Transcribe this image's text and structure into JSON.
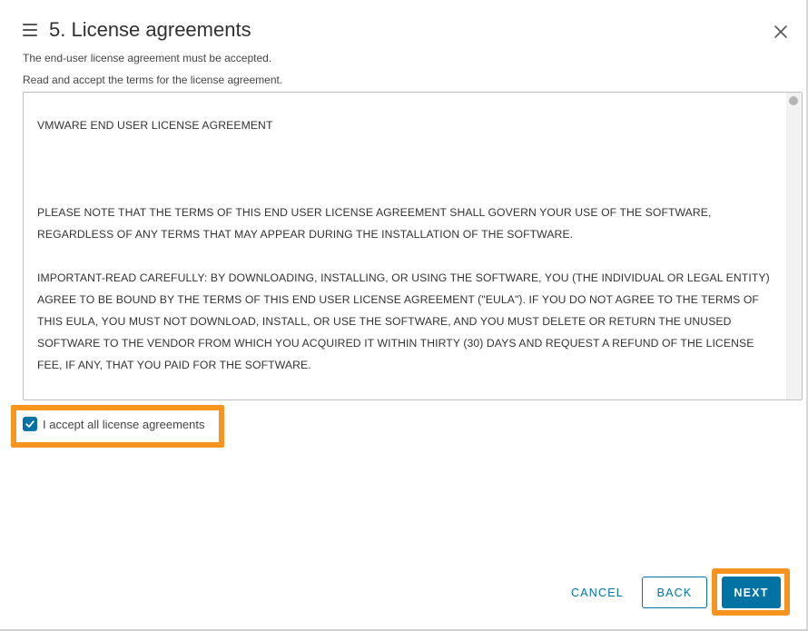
{
  "header": {
    "title": "5. License agreements"
  },
  "messages": {
    "required": "The end-user license agreement must be accepted.",
    "instruction": "Read and accept the terms for the license agreement."
  },
  "license": {
    "heading": "VMWARE END USER LICENSE AGREEMENT",
    "paragraph1": "PLEASE NOTE THAT THE TERMS OF THIS END USER LICENSE AGREEMENT SHALL GOVERN YOUR USE OF THE SOFTWARE, REGARDLESS OF ANY TERMS THAT MAY APPEAR DURING THE INSTALLATION OF THE SOFTWARE.",
    "paragraph2": "IMPORTANT-READ CAREFULLY: BY DOWNLOADING, INSTALLING, OR USING THE SOFTWARE, YOU (THE INDIVIDUAL OR LEGAL ENTITY) AGREE TO BE BOUND BY THE TERMS OF THIS END USER LICENSE AGREEMENT (\"EULA\"). IF YOU DO NOT AGREE TO THE TERMS OF THIS EULA, YOU MUST NOT DOWNLOAD, INSTALL, OR USE THE SOFTWARE, AND YOU MUST DELETE OR RETURN THE UNUSED SOFTWARE TO THE VENDOR FROM WHICH YOU ACQUIRED IT WITHIN THIRTY (30) DAYS AND REQUEST A REFUND OF THE LICENSE FEE, IF ANY, THAT YOU PAID FOR THE SOFTWARE."
  },
  "accept": {
    "label": "I accept all license agreements",
    "checked": true
  },
  "footer": {
    "cancel_label": "CANCEL",
    "back_label": "BACK",
    "next_label": "NEXT"
  },
  "colors": {
    "accent": "#0072a3",
    "highlight": "#f7941d"
  },
  "icons": {
    "menu": "hamburger-menu-icon",
    "close": "close-icon",
    "check": "checkmark-icon"
  }
}
